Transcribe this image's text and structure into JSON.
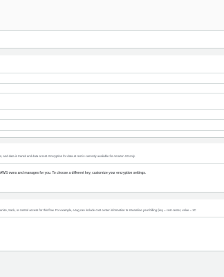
{
  "encryption": {
    "description": "s, and data in transit and data at rest. Encryption for data at rest is currently available for Amazon S3 only.",
    "key_note": "AWS owns and manages for you. To choose a different key, customize your encryption settings."
  },
  "tags": {
    "description": "anize, track, or control access for this flow. For example, a tag can include cost center information to streamline your billing (key = cost center, value = 1C"
  }
}
